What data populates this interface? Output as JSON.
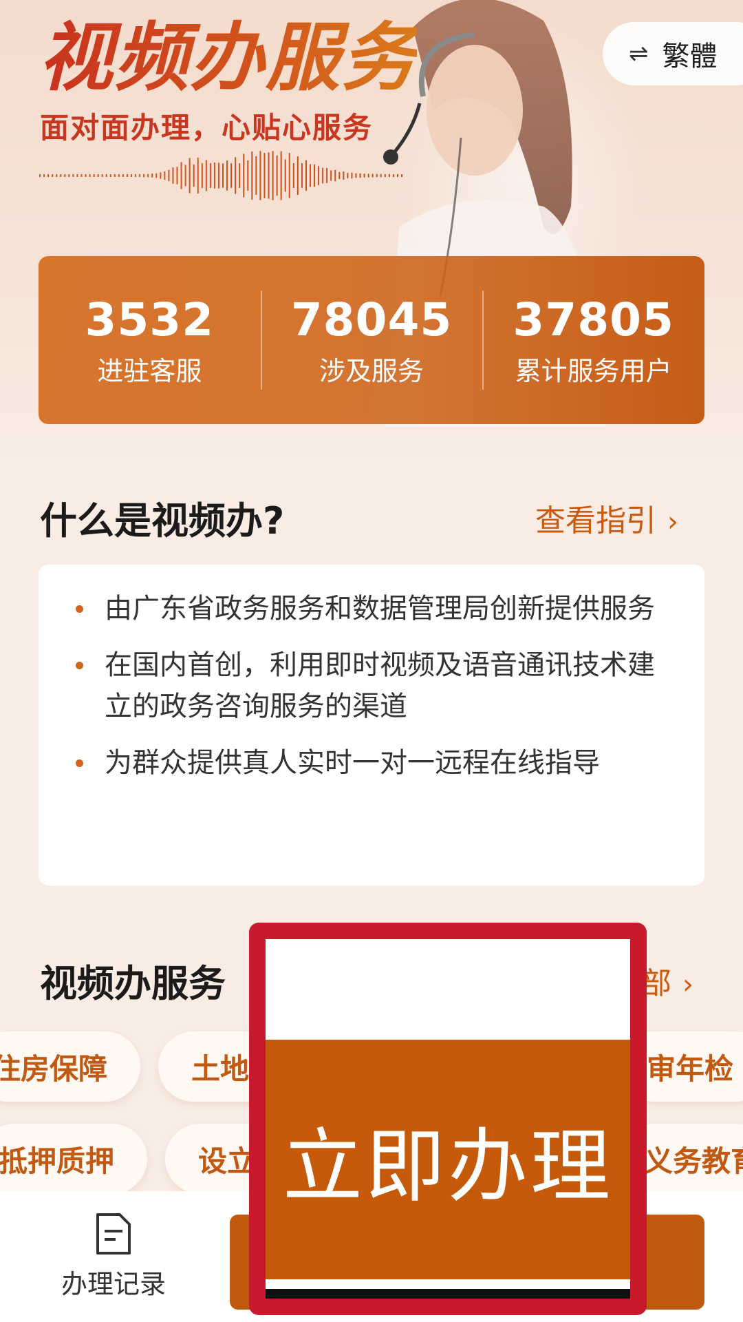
{
  "header": {
    "title": "视频办服务",
    "subtitle": "面对面办理，心贴心服务",
    "lang_toggle": "繁體"
  },
  "stats": [
    {
      "value": "3532",
      "label": "进驻客服"
    },
    {
      "value": "78045",
      "label": "涉及服务"
    },
    {
      "value": "37805",
      "label": "累计服务用户"
    }
  ],
  "about": {
    "title": "什么是视频办?",
    "link": "查看指引",
    "items": [
      "由广东省政务服务和数据管理局创新提供服务",
      "在国内首创，利用即时视频及语音通讯技术建立的政务咨询服务的渠道",
      "为群众提供真人实时一对一远程在线指导"
    ]
  },
  "services": {
    "title": "视频办服务",
    "link": "部",
    "row1": [
      "住房保障",
      "土地",
      "审年检"
    ],
    "row2": [
      "抵押质押",
      "设立",
      "义务教育"
    ]
  },
  "bottom": {
    "record_label": "办理记录"
  },
  "popup": {
    "label": "立即办理"
  },
  "colors": {
    "accent": "#c15a0e",
    "title_red": "#c8321e",
    "highlight_border": "#c8192d"
  }
}
